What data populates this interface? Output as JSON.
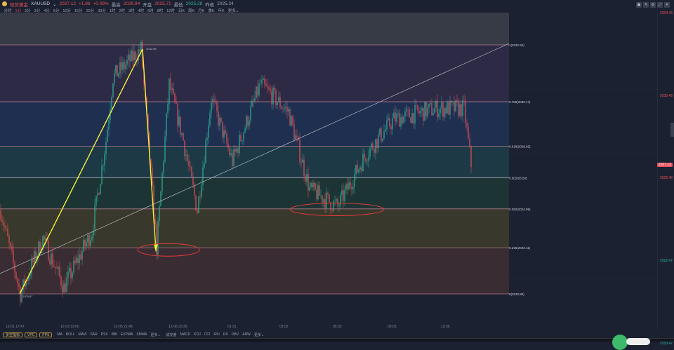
{
  "header": {
    "name": "现货黄金",
    "symbol": "XAUUSD",
    "dropdown": "⌄",
    "last": "2027.12",
    "change": "+1.88",
    "change_pct": "+0.09%",
    "high_label": "最高",
    "high": "2029.94",
    "open_label": "开盘",
    "open": "2025.71",
    "low_label": "最低",
    "low": "2025.28",
    "prev_label": "昨收",
    "prev": "2025.24"
  },
  "timeframes": [
    "分时",
    "1分",
    "2分",
    "3分",
    "4分",
    "5分",
    "10分",
    "15分",
    "20分",
    "30分",
    "1时",
    "2时",
    "3时",
    "4时",
    "6时",
    "8时",
    "12时",
    "日K",
    "周K",
    "月K",
    "季K",
    "年K",
    "更多⌄"
  ],
  "active_timeframe": 1,
  "tools": [
    "▣",
    "✎",
    "⚙",
    "⤢",
    "✕"
  ],
  "fib_levels": [
    {
      "label": "1(2032.92)",
      "ratio": 1,
      "price": 2032.92,
      "fill": "#2d2a45"
    },
    {
      "label": "0.786(2030.17)",
      "ratio": 0.786,
      "price": 2030.17,
      "fill": "#1f2f50"
    },
    {
      "label": "0.618(2028.02)",
      "ratio": 0.618,
      "price": 2028.02,
      "fill": "#1d3946"
    },
    {
      "label": "0.5(2026.50)",
      "ratio": 0.5,
      "price": 2026.5,
      "fill": "#1d3434"
    },
    {
      "label": "0.382(2024.99)",
      "ratio": 0.382,
      "price": 2024.99,
      "fill": "#38382c"
    },
    {
      "label": "0.236(2023.11)",
      "ratio": 0.236,
      "price": 2023.11,
      "fill": "#3a2c33"
    },
    {
      "label": "0(2020.88)",
      "ratio": 0,
      "price": 2020.88,
      "fill": null
    }
  ],
  "annotations": {
    "low_label": "2020.87",
    "high_label": "2032.98"
  },
  "axis": {
    "labels": [
      "2034.45",
      "2030.46",
      "2026.46",
      "2022.47",
      "2018.47"
    ],
    "current": "2027.12"
  },
  "xlabels": [
    "12-01 17:47",
    "12-03 19:00",
    "12-05 21:48",
    "12-06 23:30",
    "01:31",
    "03:02",
    "05:32",
    "08:05",
    "10:36"
  ],
  "bottom": {
    "buttons": [
      "多空指标",
      "VPC",
      "PPS"
    ],
    "main_indicators": [
      "MA",
      "BOLL",
      "MAVI",
      "SAR",
      "PSX",
      "BBI",
      "EXPMA",
      "SMMA",
      "更多⌄"
    ],
    "sub_indicators": [
      "成交量",
      "MACD",
      "KDJ",
      "CCI",
      "RSI",
      "RS",
      "OBV",
      "ARW",
      "更多⌄"
    ]
  },
  "colors": {
    "up": "#2fb39a",
    "down": "#e8505b",
    "fib_arrow": "#f2f23a",
    "ellipse": "#e03a3a"
  },
  "chart_data": {
    "type": "candlestick",
    "price_range": [
      2018.0,
      2034.9
    ],
    "path": [
      [
        0,
        2024.92
      ],
      [
        28,
        2020.88
      ],
      [
        60,
        2023.56
      ],
      [
        90,
        2021.19
      ],
      [
        130,
        2023.9
      ],
      [
        150,
        2028.31
      ],
      [
        160,
        2031.36
      ],
      [
        200,
        2032.72
      ],
      [
        222,
        2023.11
      ],
      [
        240,
        2031.02
      ],
      [
        260,
        2028.31
      ],
      [
        280,
        2024.92
      ],
      [
        300,
        2030.34
      ],
      [
        330,
        2027.29
      ],
      [
        370,
        2031.02
      ],
      [
        410,
        2029.67
      ],
      [
        440,
        2025.94
      ],
      [
        480,
        2025.09
      ],
      [
        520,
        2027.63
      ],
      [
        560,
        2029.33
      ],
      [
        620,
        2029.84
      ],
      [
        660,
        2029.84
      ],
      [
        670,
        2027.12
      ]
    ]
  }
}
